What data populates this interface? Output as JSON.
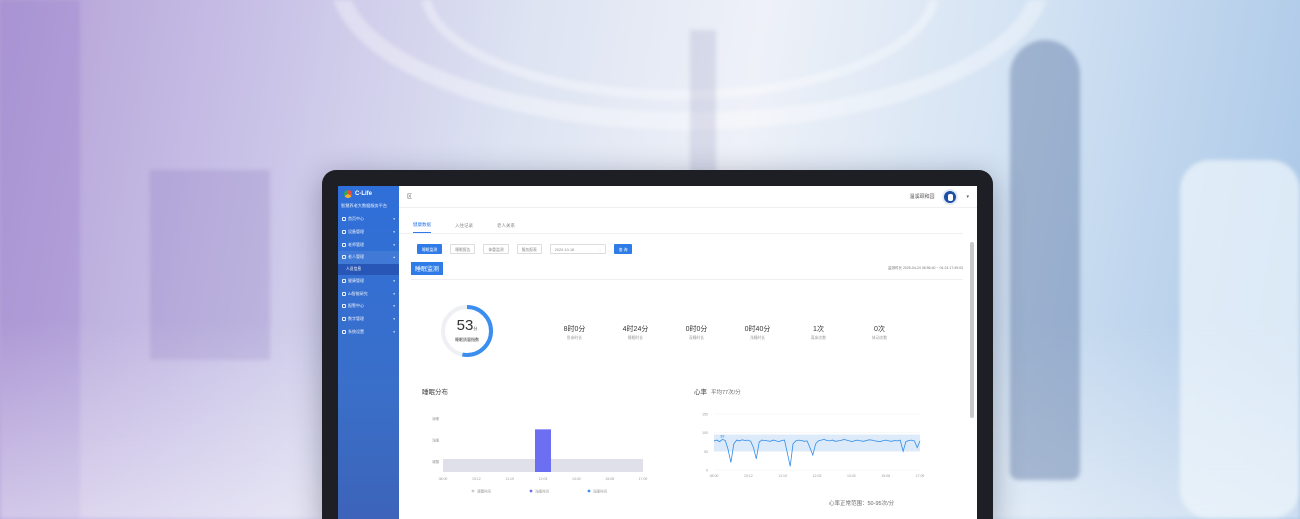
{
  "app": {
    "logo_text": "C-Life",
    "platform": "智慧养老大数据服务平台"
  },
  "sidebar": {
    "items": [
      {
        "label": "首页中心",
        "expanded": false
      },
      {
        "label": "设备管理",
        "expanded": false
      },
      {
        "label": "老师管理",
        "expanded": false
      },
      {
        "label": "老人管理",
        "expanded": true,
        "active": true
      },
      {
        "label": "健康管理",
        "expanded": false
      },
      {
        "label": "AI智能研究",
        "expanded": false
      },
      {
        "label": "报警中心",
        "expanded": false
      },
      {
        "label": "数字管理",
        "expanded": false
      },
      {
        "label": "系统设置",
        "expanded": false
      }
    ],
    "sub_item": "人员信息"
  },
  "topbar": {
    "left": "区",
    "org": "温溪颐和园"
  },
  "tabs": [
    {
      "label": "健康数据",
      "active": true
    },
    {
      "label": "入住记录",
      "active": false
    },
    {
      "label": "老人关系",
      "active": false
    }
  ],
  "filters": {
    "buttons": [
      "睡眠监测",
      "睡眠报告",
      "体重监测",
      "服务报表"
    ],
    "date": "2020-10-18",
    "query": "查 询"
  },
  "section": {
    "title": "睡眠监测",
    "meta": "监测时长  2025-04-24 08:56:40 ~ 04-24 17:39:03"
  },
  "score": {
    "value": "53",
    "unit": "分",
    "caption": "睡眠质量指数",
    "fraction": 0.53
  },
  "stats": [
    {
      "value": "8时0分",
      "label": "卧床时长"
    },
    {
      "value": "4时24分",
      "label": "睡眠时长"
    },
    {
      "value": "0时0分",
      "label": "深睡时长"
    },
    {
      "value": "0时40分",
      "label": "浅睡时长"
    },
    {
      "value": "1次",
      "label": "离床次数"
    },
    {
      "value": "0次",
      "label": "体动次数"
    }
  ],
  "sleep_panel": {
    "title": "睡眠分布"
  },
  "hr_panel": {
    "title": "心率",
    "subtitle": "平均77次/分",
    "peak_label": "82",
    "note": "心率正常范围：50-95次/分"
  },
  "colors": {
    "accent": "#2f7be8",
    "bar": "#6d6ff2",
    "band": "#dfe0ea",
    "hr_band": "#dceaf9"
  },
  "chart_data": [
    {
      "type": "bar",
      "title": "睡眠分布",
      "categories": [
        "清醒",
        "浅睡",
        "深睡"
      ],
      "x_ticks": [
        "08:00",
        "10:12",
        "11:19",
        "12:03",
        "13:40",
        "15:08",
        "17:09"
      ],
      "series": [
        {
          "name": "浅睡",
          "values": [
            {
              "x": "12:03",
              "level": "浅睡"
            }
          ]
        }
      ],
      "legend": [
        "清醒时间",
        "浅睡时间",
        "深睡时间"
      ],
      "legend_position": "bottom"
    },
    {
      "type": "line",
      "title": "心率",
      "x_ticks": [
        "08:00",
        "10:12",
        "11:19",
        "12:03",
        "13:40",
        "15:08",
        "17:09"
      ],
      "y_ticks": [
        0,
        50,
        100,
        150
      ],
      "ylim": [
        0,
        150
      ],
      "normal_range": [
        50,
        95
      ],
      "series": [
        {
          "values": [
            78,
            80,
            76,
            82,
            79,
            55,
            20,
            70,
            80,
            78,
            81,
            79,
            80,
            77,
            60,
            30,
            75,
            80,
            79,
            78,
            77,
            80,
            78,
            76,
            79,
            80,
            45,
            10,
            70,
            78,
            80,
            79,
            77,
            78,
            60,
            40,
            70,
            78,
            80,
            82,
            79,
            78,
            80,
            77,
            78,
            79,
            82,
            80,
            78,
            76,
            79,
            80,
            78,
            77,
            79,
            81,
            80,
            78,
            77,
            76,
            79,
            80,
            78,
            77,
            79,
            78,
            80,
            50,
            76,
            79,
            80,
            78,
            60,
            78
          ]
        }
      ]
    }
  ]
}
